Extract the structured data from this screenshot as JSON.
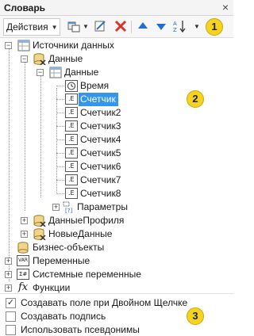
{
  "window": {
    "title": "Словарь",
    "close_glyph": "×"
  },
  "toolbar": {
    "actions_label": "Действия",
    "icons": [
      "new-item-icon",
      "edit-icon",
      "delete-icon",
      "move-up-icon",
      "move-down-icon",
      "sort-icon"
    ],
    "badge": "1"
  },
  "tree": {
    "badge": "2",
    "root": "Источники данных",
    "data_group": "Данные",
    "data_table": "Данные",
    "fields": [
      "Время",
      "Счетчик",
      "Счетчик2",
      "Счетчик3",
      "Счетчик4",
      "Счетчик5",
      "Счетчик6",
      "Счетчик7",
      "Счетчик8"
    ],
    "params": "Параметры",
    "profile_data": "ДанныеПрофиля",
    "new_data": "НовыеДанные",
    "business_objects": "Бизнес-объекты",
    "variables": "Переменные",
    "system_variables": "Системные переменные",
    "functions": "Функции",
    "selected_field": "Счетчик",
    "field_icon_text": ".E",
    "var_icon_text": "VAR",
    "sysvar_icon_text": "Σ#",
    "func_icon_text": "fx",
    "params_icon_text": "[?]",
    "expand_plus": "+",
    "expand_minus": "−"
  },
  "options": {
    "badge": "3",
    "items": [
      {
        "label": "Создавать поле при Двойном Щелчке",
        "checked": true
      },
      {
        "label": "Создавать подпись",
        "checked": false
      },
      {
        "label": "Использовать псевдонимы",
        "checked": false
      }
    ],
    "check_glyph": "✓"
  },
  "colors": {
    "selection": "#3296f0",
    "badge": "#f5d31f",
    "delete": "#d7332b",
    "arrows": "#1f6fd1"
  }
}
